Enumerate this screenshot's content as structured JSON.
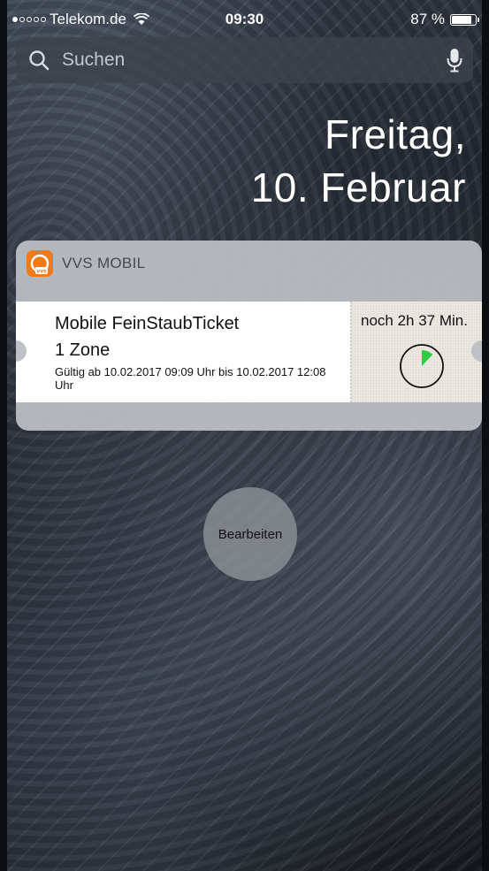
{
  "status_bar": {
    "carrier": "Telekom.de",
    "signal_bars_filled": 1,
    "signal_bars_total": 5,
    "time": "09:30",
    "battery_text": "87 %",
    "battery_level": 0.87
  },
  "search": {
    "placeholder": "Suchen",
    "icon": "search-icon",
    "mic_icon": "microphone-icon"
  },
  "date": {
    "weekday": "Freitag,",
    "day_month": "10. Februar"
  },
  "widget": {
    "app_name": "VVS MOBIL",
    "app_icon_color": "#f07a1a",
    "ticket": {
      "name": "Mobile FeinStaubTicket",
      "zone": "1 Zone",
      "validity": "Gültig ab 10.02.2017 09:09 Uhr bis 10.02.2017 12:08 Uhr",
      "remaining": "noch 2h 37 Min.",
      "elapsed_fraction": 0.12,
      "timer_color": "#2ecc40"
    }
  },
  "edit_button": {
    "label": "Bearbeiten"
  }
}
